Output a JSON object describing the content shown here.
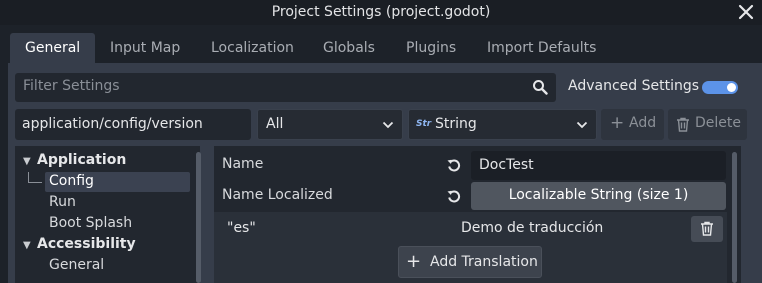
{
  "window": {
    "title": "Project Settings (project.godot)"
  },
  "tabs": [
    {
      "label": "General"
    },
    {
      "label": "Input Map"
    },
    {
      "label": "Localization"
    },
    {
      "label": "Globals"
    },
    {
      "label": "Plugins"
    },
    {
      "label": "Import Defaults"
    }
  ],
  "active_tab": "General",
  "filter": {
    "placeholder": "Filter Settings"
  },
  "advanced": {
    "label": "Advanced Settings",
    "enabled": true
  },
  "toolbar": {
    "path_value": "application/config/version",
    "category_select": "All",
    "type_select": "String",
    "type_icon": "Str",
    "add_label": "Add",
    "delete_label": "Delete"
  },
  "tree": {
    "items": [
      {
        "label": "Application",
        "kind": "category",
        "expanded": true
      },
      {
        "label": "Config",
        "kind": "item",
        "selected": true
      },
      {
        "label": "Run",
        "kind": "item"
      },
      {
        "label": "Boot Splash",
        "kind": "item"
      },
      {
        "label": "Accessibility",
        "kind": "category",
        "expanded": true
      },
      {
        "label": "General",
        "kind": "item"
      }
    ]
  },
  "inspector": {
    "name": {
      "label": "Name",
      "value": "DocTest"
    },
    "name_localized": {
      "label": "Name Localized",
      "value": "Localizable String (size 1)"
    },
    "translations": [
      {
        "key": "\"es\"",
        "value": "Demo de traducción"
      }
    ],
    "add_translation_label": "Add Translation"
  },
  "colors": {
    "accent": "#5c93e8",
    "panel": "#363d4a",
    "background": "#1d2229",
    "field": "#22272f"
  }
}
